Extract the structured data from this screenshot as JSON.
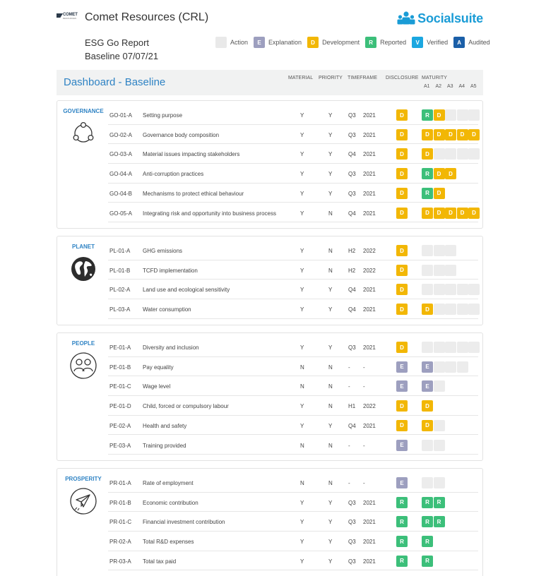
{
  "header": {
    "logo_text": "COMET",
    "logo_subtext": "RESOURCES",
    "company": "Comet Resources (CRL)",
    "brand": "Socialsuite"
  },
  "report": {
    "title": "ESG Go Report",
    "baseline": "Baseline 07/07/21"
  },
  "legend": [
    {
      "letter": "",
      "label": "Action",
      "status": "action"
    },
    {
      "letter": "E",
      "label": "Explanation",
      "status": "explanation"
    },
    {
      "letter": "D",
      "label": "Development",
      "status": "development"
    },
    {
      "letter": "R",
      "label": "Reported",
      "status": "reported"
    },
    {
      "letter": "V",
      "label": "Verified",
      "status": "verified"
    },
    {
      "letter": "A",
      "label": "Audited",
      "status": "audited"
    }
  ],
  "colors": {
    "action": "#e9e9e9",
    "explanation": "#9d9fbf",
    "development": "#f2b705",
    "reported": "#3cbf7a",
    "verified": "#1ba7e0",
    "audited": "#1b5fa8",
    "accent": "#2f83c4",
    "brand": "#1a9cd6"
  },
  "dashboard": {
    "title": "Dashboard - Baseline",
    "columns": {
      "material": "MATERIAL",
      "priority": "PRIORITY",
      "timeframe": "TIMEFRAME",
      "disclosure": "DISCLOSURE",
      "maturity": "MATURITY"
    },
    "maturity_levels": [
      "A1",
      "A2",
      "A3",
      "A4",
      "A5"
    ]
  },
  "sections": [
    {
      "label": "GOVERNANCE",
      "icon": "governance-cycle-icon",
      "rows": [
        {
          "code": "GO-01-A",
          "name": "Setting purpose",
          "material": "Y",
          "priority": "Y",
          "period": "Q3",
          "year": "2021",
          "disclosure": "D",
          "maturity": [
            "R",
            "D",
            "",
            "",
            ""
          ]
        },
        {
          "code": "GO-02-A",
          "name": "Governance body composition",
          "material": "Y",
          "priority": "Y",
          "period": "Q3",
          "year": "2021",
          "disclosure": "D",
          "maturity": [
            "D",
            "D",
            "D",
            "D",
            "D"
          ]
        },
        {
          "code": "GO-03-A",
          "name": "Material issues impacting stakeholders",
          "material": "Y",
          "priority": "Y",
          "period": "Q4",
          "year": "2021",
          "disclosure": "D",
          "maturity": [
            "D",
            "",
            "",
            "",
            ""
          ]
        },
        {
          "code": "GO-04-A",
          "name": "Anti-corruption practices",
          "material": "Y",
          "priority": "Y",
          "period": "Q3",
          "year": "2021",
          "disclosure": "D",
          "maturity": [
            "R",
            "D",
            "D",
            null,
            null
          ]
        },
        {
          "code": "GO-04-B",
          "name": "Mechanisms to protect ethical behaviour",
          "material": "Y",
          "priority": "Y",
          "period": "Q3",
          "year": "2021",
          "disclosure": "D",
          "maturity": [
            "R",
            "D",
            null,
            null,
            null
          ]
        },
        {
          "code": "GO-05-A",
          "name": "Integrating risk and opportunity into business process",
          "material": "Y",
          "priority": "N",
          "period": "Q4",
          "year": "2021",
          "disclosure": "D",
          "maturity": [
            "D",
            "D",
            "D",
            "D",
            "D"
          ]
        }
      ]
    },
    {
      "label": "PLANET",
      "icon": "globe-icon",
      "rows": [
        {
          "code": "PL-01-A",
          "name": "GHG emissions",
          "material": "Y",
          "priority": "N",
          "period": "H2",
          "year": "2022",
          "disclosure": "D",
          "maturity": [
            "",
            "",
            "",
            null,
            null
          ]
        },
        {
          "code": "PL-01-B",
          "name": "TCFD implementation",
          "material": "Y",
          "priority": "N",
          "period": "H2",
          "year": "2022",
          "disclosure": "D",
          "maturity": [
            "",
            "",
            "",
            null,
            null
          ]
        },
        {
          "code": "PL-02-A",
          "name": "Land use and ecological sensitivity",
          "material": "Y",
          "priority": "Y",
          "period": "Q4",
          "year": "2021",
          "disclosure": "D",
          "maturity": [
            "",
            "",
            "",
            "",
            ""
          ]
        },
        {
          "code": "PL-03-A",
          "name": "Water consumption",
          "material": "Y",
          "priority": "Y",
          "period": "Q4",
          "year": "2021",
          "disclosure": "D",
          "maturity": [
            "D",
            "",
            "",
            "",
            ""
          ]
        }
      ]
    },
    {
      "label": "PEOPLE",
      "icon": "people-icon",
      "rows": [
        {
          "code": "PE-01-A",
          "name": "Diversity and inclusion",
          "material": "Y",
          "priority": "Y",
          "period": "Q3",
          "year": "2021",
          "disclosure": "D",
          "maturity": [
            "",
            "",
            "",
            "",
            ""
          ]
        },
        {
          "code": "PE-01-B",
          "name": "Pay equality",
          "material": "N",
          "priority": "N",
          "period": "-",
          "year": "-",
          "disclosure": "E",
          "maturity": [
            "E",
            "",
            "",
            "",
            null
          ]
        },
        {
          "code": "PE-01-C",
          "name": "Wage level",
          "material": "N",
          "priority": "N",
          "period": "-",
          "year": "-",
          "disclosure": "E",
          "maturity": [
            "E",
            "",
            null,
            null,
            null
          ]
        },
        {
          "code": "PE-01-D",
          "name": "Child, forced or compulsory labour",
          "material": "Y",
          "priority": "N",
          "period": "H1",
          "year": "2022",
          "disclosure": "D",
          "maturity": [
            "D",
            null,
            null,
            null,
            null
          ]
        },
        {
          "code": "PE-02-A",
          "name": "Health and safety",
          "material": "Y",
          "priority": "Y",
          "period": "Q4",
          "year": "2021",
          "disclosure": "D",
          "maturity": [
            "D",
            "",
            null,
            null,
            null
          ]
        },
        {
          "code": "PE-03-A",
          "name": "Training provided",
          "material": "N",
          "priority": "N",
          "period": "-",
          "year": "-",
          "disclosure": "E",
          "maturity": [
            "",
            "",
            null,
            null,
            null
          ]
        }
      ]
    },
    {
      "label": "PROSPERITY",
      "icon": "paper-plane-icon",
      "rows": [
        {
          "code": "PR-01-A",
          "name": "Rate of employment",
          "material": "N",
          "priority": "N",
          "period": "-",
          "year": "-",
          "disclosure": "E",
          "maturity": [
            "",
            "",
            null,
            null,
            null
          ]
        },
        {
          "code": "PR-01-B",
          "name": "Economic contribution",
          "material": "Y",
          "priority": "Y",
          "period": "Q3",
          "year": "2021",
          "disclosure": "R",
          "maturity": [
            "R",
            "R",
            null,
            null,
            null
          ]
        },
        {
          "code": "PR-01-C",
          "name": "Financial investment contribution",
          "material": "Y",
          "priority": "Y",
          "period": "Q3",
          "year": "2021",
          "disclosure": "R",
          "maturity": [
            "R",
            "R",
            null,
            null,
            null
          ]
        },
        {
          "code": "PR-02-A",
          "name": "Total R&D expenses",
          "material": "Y",
          "priority": "Y",
          "period": "Q3",
          "year": "2021",
          "disclosure": "R",
          "maturity": [
            "R",
            null,
            null,
            null,
            null
          ]
        },
        {
          "code": "PR-03-A",
          "name": "Total tax paid",
          "material": "Y",
          "priority": "Y",
          "period": "Q3",
          "year": "2021",
          "disclosure": "R",
          "maturity": [
            "R",
            null,
            null,
            null,
            null
          ]
        }
      ]
    }
  ]
}
